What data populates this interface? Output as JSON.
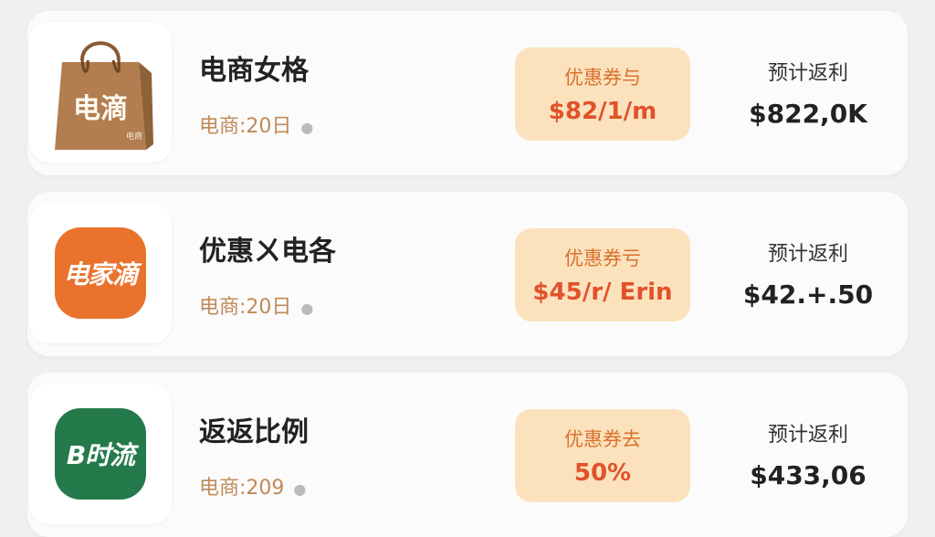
{
  "items": [
    {
      "logo_text": "电滴",
      "logo_sub": "电商",
      "title": "电商女格",
      "meta": "电商:20日",
      "coupon_label": "优惠券与",
      "coupon_value": "$82/1/m",
      "rebate_label": "预计返利",
      "rebate_value": "$822,0K"
    },
    {
      "logo_text": "电家滴",
      "title": "优惠ㄨ电各",
      "meta": "电商:20日",
      "coupon_label": "优惠券亏",
      "coupon_value": "$45/r/ Erin",
      "rebate_label": "预计返利",
      "rebate_value": "$42.+.50"
    },
    {
      "logo_text": "B时流",
      "title": "返返比例",
      "meta": "电商:209",
      "coupon_label": "优惠券去",
      "coupon_value": "50%",
      "rebate_label": "预计返利",
      "rebate_value": "$433,06"
    }
  ],
  "colors": {
    "card_bg": "#fbfbfb",
    "coupon_bg": "#fbe2bd",
    "coupon_value": "#e0522b",
    "meta_text": "#c08a57",
    "logo_orange": "#e9732d",
    "logo_green": "#257a4c",
    "bag_brown": "#b27d4f"
  },
  "icons": [
    "shopping-bag-icon",
    "dot-icon"
  ]
}
